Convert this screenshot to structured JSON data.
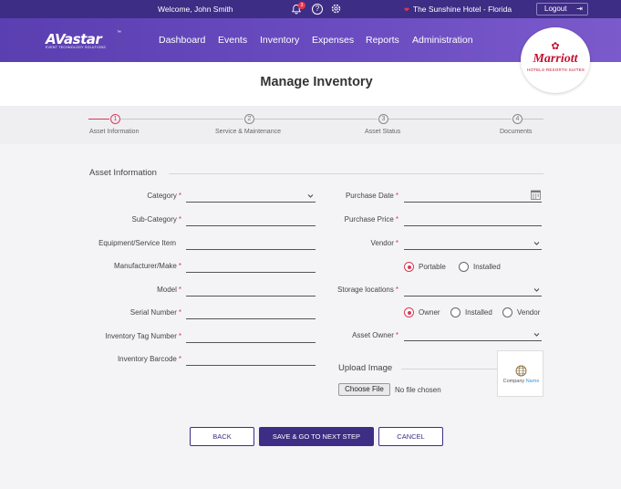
{
  "topbar": {
    "welcome_prefix": "Welcome, ",
    "user_name": "John Smith",
    "notification_count": "3",
    "help_glyph": "?",
    "hotel": "The Sunshine Hotel - Florida",
    "logout": "Logout",
    "accent": "#e8364a"
  },
  "brand": {
    "logo_main": "AVastar",
    "logo_tm": "™",
    "logo_sub": "EVENT TECHNOLOGY SOLUTIONS",
    "client_name": "Marriott",
    "client_tagline": "HOTELS·RESORTS·SUITES"
  },
  "nav": {
    "items": [
      "Dashboard",
      "Events",
      "Inventory",
      "Expenses",
      "Reports",
      "Administration"
    ]
  },
  "page": {
    "title": "Manage Inventory"
  },
  "stepper": {
    "steps": [
      {
        "num": "1",
        "label": "Asset Information"
      },
      {
        "num": "2",
        "label": "Service & Maintenance"
      },
      {
        "num": "3",
        "label": "Asset Status"
      },
      {
        "num": "4",
        "label": "Documents"
      }
    ],
    "active_color": "#d63a57"
  },
  "form": {
    "section_title": "Asset Information",
    "required_mark": "*",
    "left": {
      "category": "Category",
      "sub_category": "Sub-Category",
      "equipment": "Equipment/Service Item",
      "manufacturer": "Manufacturer/Make",
      "model": "Model",
      "serial": "Serial Number",
      "inventory_tag": "Inventory Tag Number",
      "barcode": "Inventory Barcode"
    },
    "right": {
      "purchase_date": "Purchase Date",
      "purchase_price": "Purchase Price",
      "vendor": "Vendor",
      "type_options": [
        "Portable",
        "Installed"
      ],
      "storage": "Storage locations",
      "ownership_options": [
        "Owner",
        "Installed",
        "Vendor"
      ],
      "asset_owner": "Asset Owner"
    },
    "upload": {
      "title": "Upload Image",
      "choose": "Choose File",
      "no_file": "No file chosen",
      "company_pre": "Company ",
      "company_hl": "Name"
    }
  },
  "actions": {
    "back": "BACK",
    "save_next": "SAVE & GO TO NEXT STEP",
    "cancel": "CANCEL"
  }
}
